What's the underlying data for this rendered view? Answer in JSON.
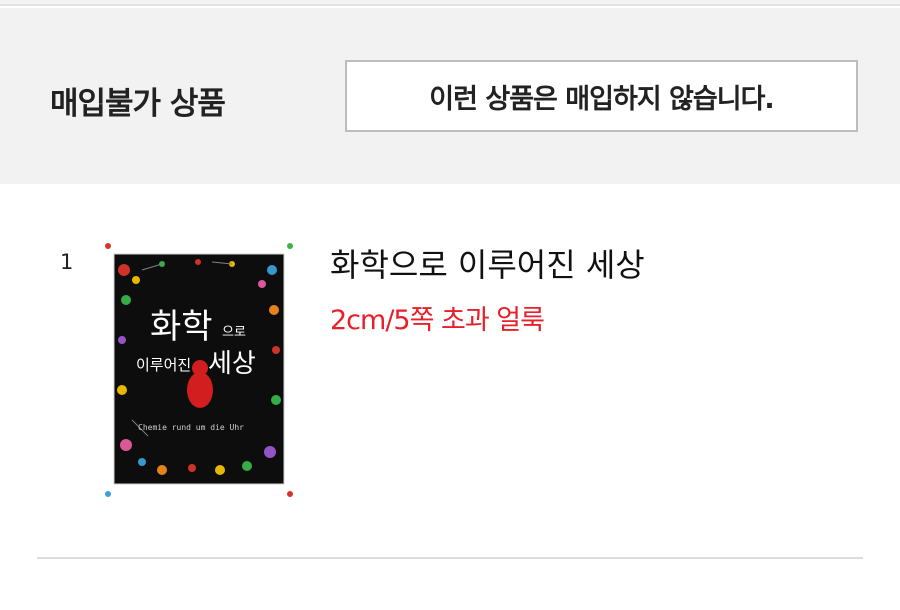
{
  "header": {
    "title": "매입불가 상품",
    "notice": "이런 상품은 매입하지 않습니다."
  },
  "items": [
    {
      "index": "1",
      "title": "화학으로 이루어진 세상",
      "reason": "2cm/5쪽 초과 얼룩",
      "cover": {
        "title_line1": "화학",
        "title_small": "으로",
        "title_line2_small": "이루어진",
        "title_line2_big": "세상",
        "subtitle": "Chemie rund um die Uhr"
      }
    }
  ],
  "colors": {
    "reason_red": "#e8202a",
    "band_gray": "#f2f2f2",
    "cover_bg": "#111111"
  }
}
